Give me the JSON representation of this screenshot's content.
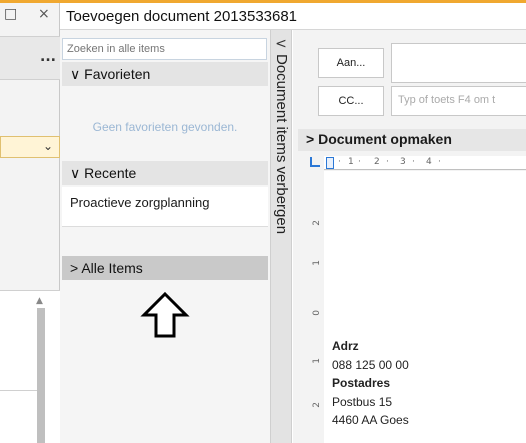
{
  "window": {
    "title": "Toevoegen document 2013533681",
    "close_glyph": "×",
    "max_glyph": "□",
    "more_glyph": "..."
  },
  "items_panel": {
    "search": {
      "placeholder": "Zoeken in alle items",
      "value": ""
    },
    "favorites": {
      "label": "Favorieten",
      "empty_text": "Geen favorieten gevonden."
    },
    "recent": {
      "label": "Recente",
      "items": [
        "Proactieve zorgplanning"
      ]
    },
    "all_items": {
      "label": "Alle Items"
    },
    "hide_tab_label": "Document items verbergen"
  },
  "compose": {
    "to_label": "Aan...",
    "to_value": "",
    "cc_label": "CC...",
    "cc_placeholder": "Typ of toets F4 om t",
    "document_section_label": "Document opmaken"
  },
  "ruler": {
    "h_ticks": [
      "1",
      "2",
      "3",
      "4"
    ],
    "v_ticks": [
      "2",
      "1",
      "0",
      "1",
      "2"
    ]
  },
  "document": {
    "lines": [
      {
        "text": "Adrz",
        "bold": true
      },
      {
        "text": "088 125 00 00",
        "bold": false
      },
      {
        "text": "Postadres",
        "bold": true
      },
      {
        "text": "Postbus 15",
        "bold": false
      },
      {
        "text": "4460 AA  Goes",
        "bold": false
      }
    ]
  },
  "icons": {
    "collapsed_chevron": "›",
    "expanded_chevron": "⌄",
    "up_arrow": "up-outline-arrow-icon"
  },
  "colors": {
    "accent": "#f0a830",
    "ruler_blue": "#2b78d6",
    "placeholder_blue": "#7a98b8"
  }
}
